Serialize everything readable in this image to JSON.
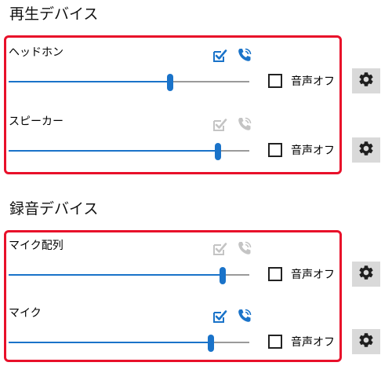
{
  "colors": {
    "accent": "#1a73c9",
    "group_border": "#e8102a",
    "icon_disabled": "#c4c4c4",
    "button_bg": "#d9d9d9"
  },
  "playback": {
    "title": "再生デバイス",
    "devices": [
      {
        "label": "ヘッドホン",
        "default_icon": "checkmark-icon",
        "default_active": true,
        "comm_icon": "phone-icon",
        "comm_active": true,
        "volume": 0.67,
        "mute_label": "音声オフ",
        "mute_checked": false,
        "settings_icon": "gear-icon"
      },
      {
        "label": "スピーカー",
        "default_icon": "checkmark-icon",
        "default_active": false,
        "comm_icon": "phone-icon",
        "comm_active": false,
        "volume": 0.87,
        "mute_label": "音声オフ",
        "mute_checked": false,
        "settings_icon": "gear-icon"
      }
    ]
  },
  "recording": {
    "title": "録音デバイス",
    "devices": [
      {
        "label": "マイク配列",
        "default_icon": "checkmark-icon",
        "default_active": false,
        "comm_icon": "phone-icon",
        "comm_active": false,
        "volume": 0.89,
        "mute_label": "音声オフ",
        "mute_checked": false,
        "settings_icon": "gear-icon"
      },
      {
        "label": "マイク",
        "default_icon": "checkmark-icon",
        "default_active": true,
        "comm_icon": "phone-icon",
        "comm_active": true,
        "volume": 0.84,
        "mute_label": "音声オフ",
        "mute_checked": false,
        "settings_icon": "gear-icon"
      }
    ]
  }
}
